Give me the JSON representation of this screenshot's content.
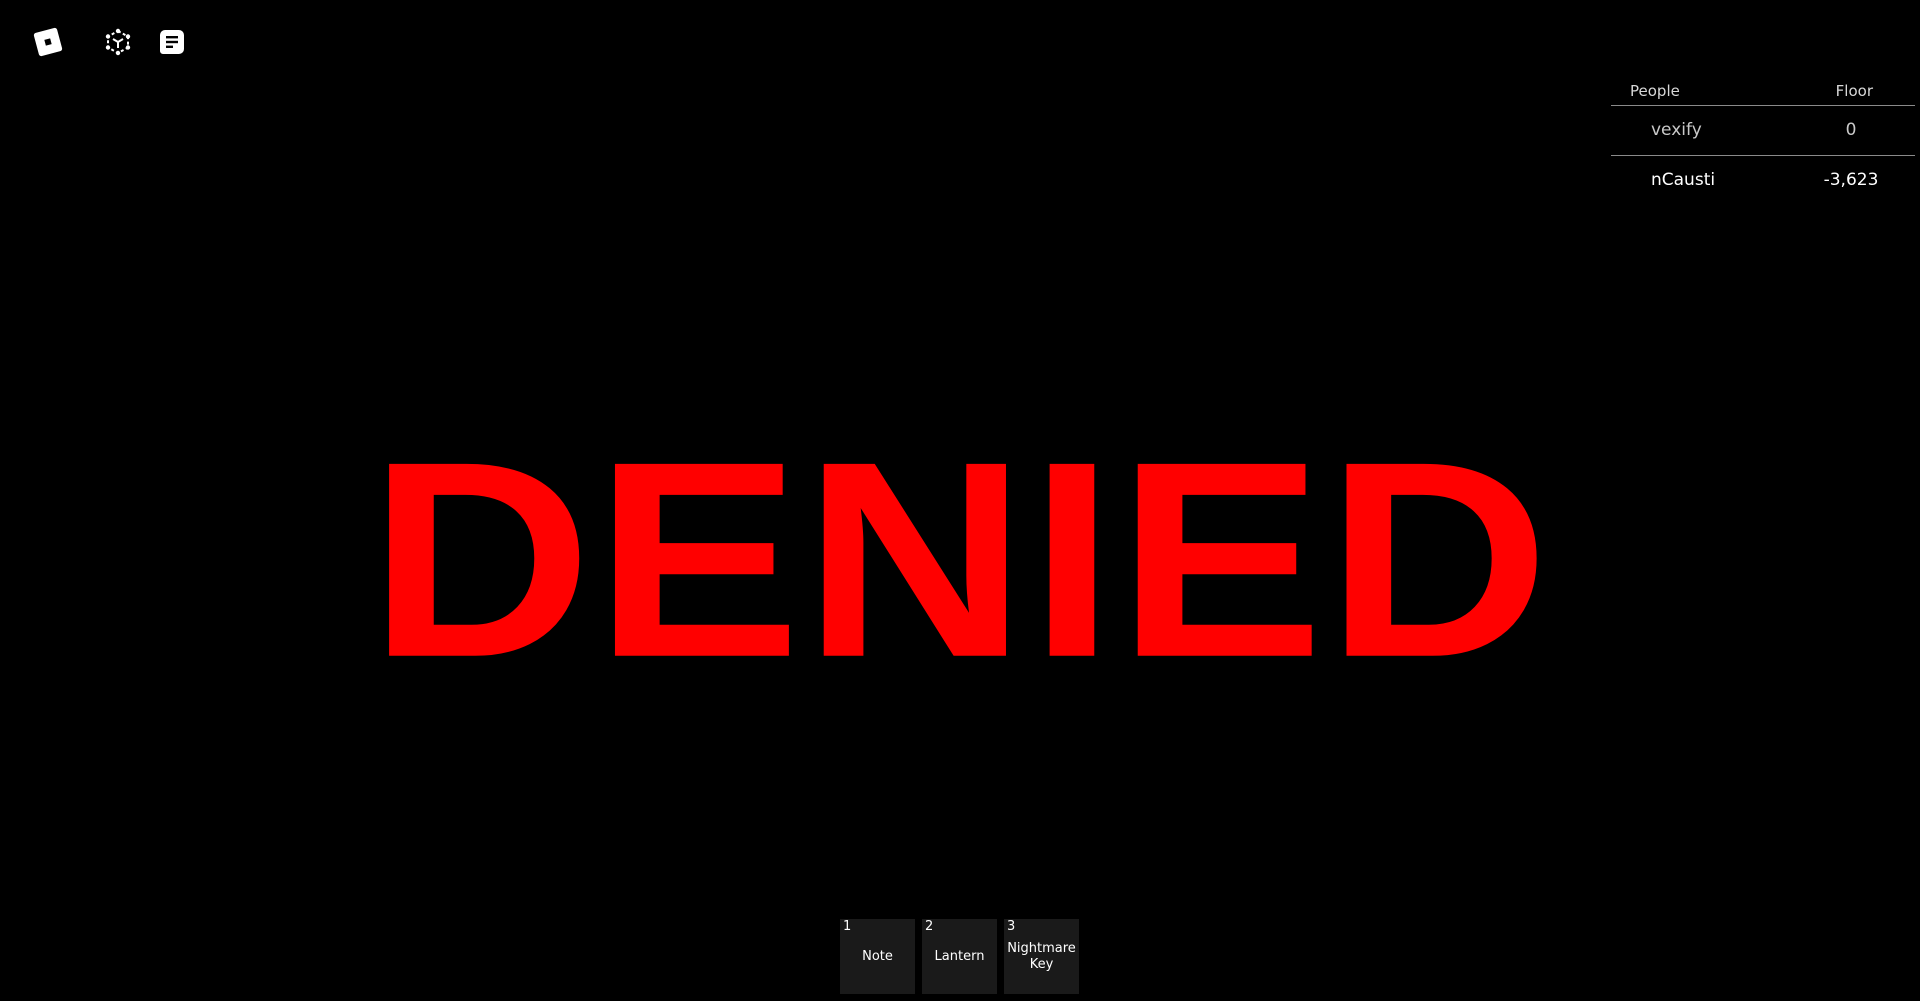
{
  "top_bar": {
    "icons": [
      {
        "name": "roblox-menu-icon"
      },
      {
        "name": "emotes-icon"
      },
      {
        "name": "chat-icon"
      }
    ]
  },
  "leaderboard": {
    "headers": {
      "people": "People",
      "floor": "Floor"
    },
    "rows": [
      {
        "name": "vexify",
        "floor": "0"
      },
      {
        "name": "nCausti",
        "floor": "-3,623"
      }
    ]
  },
  "message": {
    "text": "DENIED",
    "color": "#ff0000"
  },
  "hotbar": {
    "slots": [
      {
        "number": "1",
        "label": "Note"
      },
      {
        "number": "2",
        "label": "Lantern"
      },
      {
        "number": "3",
        "label": "NightmareKey"
      }
    ]
  }
}
